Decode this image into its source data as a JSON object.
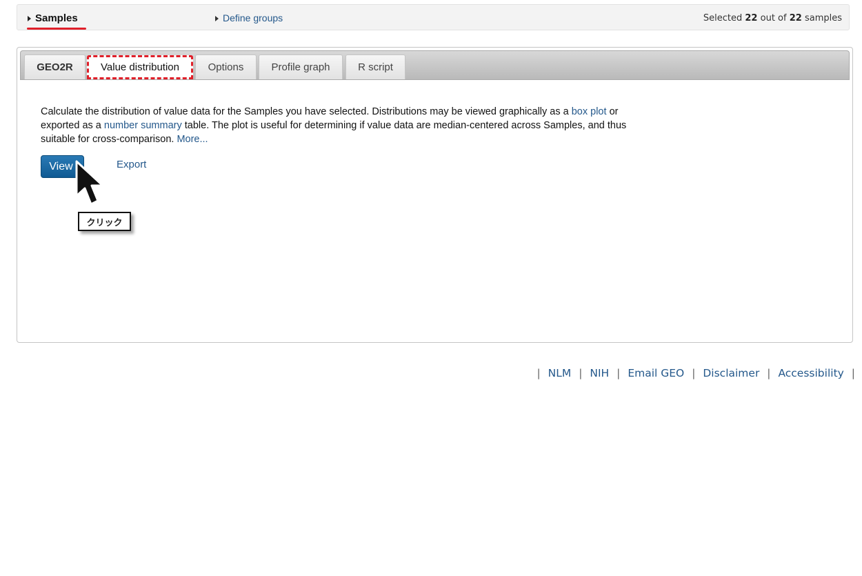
{
  "header": {
    "samples_label": "Samples",
    "define_groups_label": "Define groups",
    "selected": {
      "prefix": "Selected",
      "count": "22",
      "middle": "out of",
      "total": "22",
      "suffix": "samples"
    }
  },
  "tabs": [
    {
      "label": "GEO2R"
    },
    {
      "label": "Value distribution"
    },
    {
      "label": "Options"
    },
    {
      "label": "Profile graph"
    },
    {
      "label": "R script"
    }
  ],
  "active_tab": "Value distribution",
  "content": {
    "desc_1": "Calculate the distribution of value data for the Samples you have selected. Distributions may be viewed graphically as a",
    "box_plot_link": "box plot",
    "desc_2": "or exported as a",
    "number_summary_link": "number summary",
    "desc_3": "table. The plot is useful for determining if value data are median-centered across Samples, and thus suitable for cross-comparison.",
    "more_link": "More...",
    "view_button": "View",
    "export_link": "Export"
  },
  "annotation": {
    "callout_text": "クリック",
    "cursor_icon": "arrow-cursor-icon"
  },
  "footer": {
    "links": [
      "NLM",
      "NIH",
      "Email GEO",
      "Disclaimer",
      "Accessibility"
    ]
  },
  "colors": {
    "link": "#24588b",
    "button": "#1a6aa3",
    "highlight": "#e0202a"
  }
}
